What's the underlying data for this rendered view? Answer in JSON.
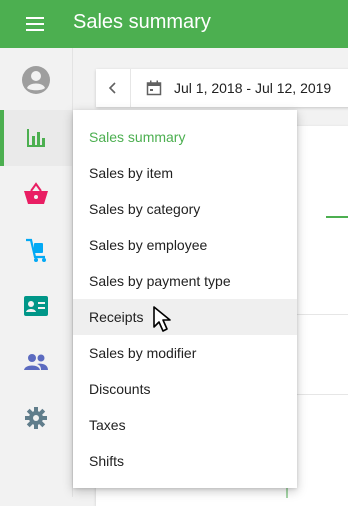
{
  "app": {
    "title": "Sales summary"
  },
  "colors": {
    "brand": "#4caf50",
    "selected_text": "#4caf50",
    "icon_basket": "#e91e63",
    "icon_items": "#03a9f4",
    "icon_employees": "#009688",
    "icon_customers": "#5c6bc0",
    "icon_settings": "#607d8b",
    "icon_profile": "#9e9e9e",
    "icon_reports": "#4caf50"
  },
  "sidebar": {
    "items": [
      {
        "name": "profile",
        "icon": "account-circle-icon"
      },
      {
        "name": "reports",
        "icon": "bar-chart-icon",
        "active": true
      },
      {
        "name": "sales",
        "icon": "basket-icon"
      },
      {
        "name": "items",
        "icon": "items-cart-icon"
      },
      {
        "name": "employees",
        "icon": "badge-icon"
      },
      {
        "name": "customers",
        "icon": "people-icon"
      },
      {
        "name": "settings",
        "icon": "gear-icon"
      }
    ]
  },
  "date_filter": {
    "range": "Jul 1, 2018 - Jul 12, 2019"
  },
  "report_menu": {
    "selected": "Sales summary",
    "hovered": "Receipts",
    "items": [
      "Sales summary",
      "Sales by item",
      "Sales by category",
      "Sales by employee",
      "Sales by payment type",
      "Receipts",
      "Sales by modifier",
      "Discounts",
      "Taxes",
      "Shifts"
    ]
  }
}
